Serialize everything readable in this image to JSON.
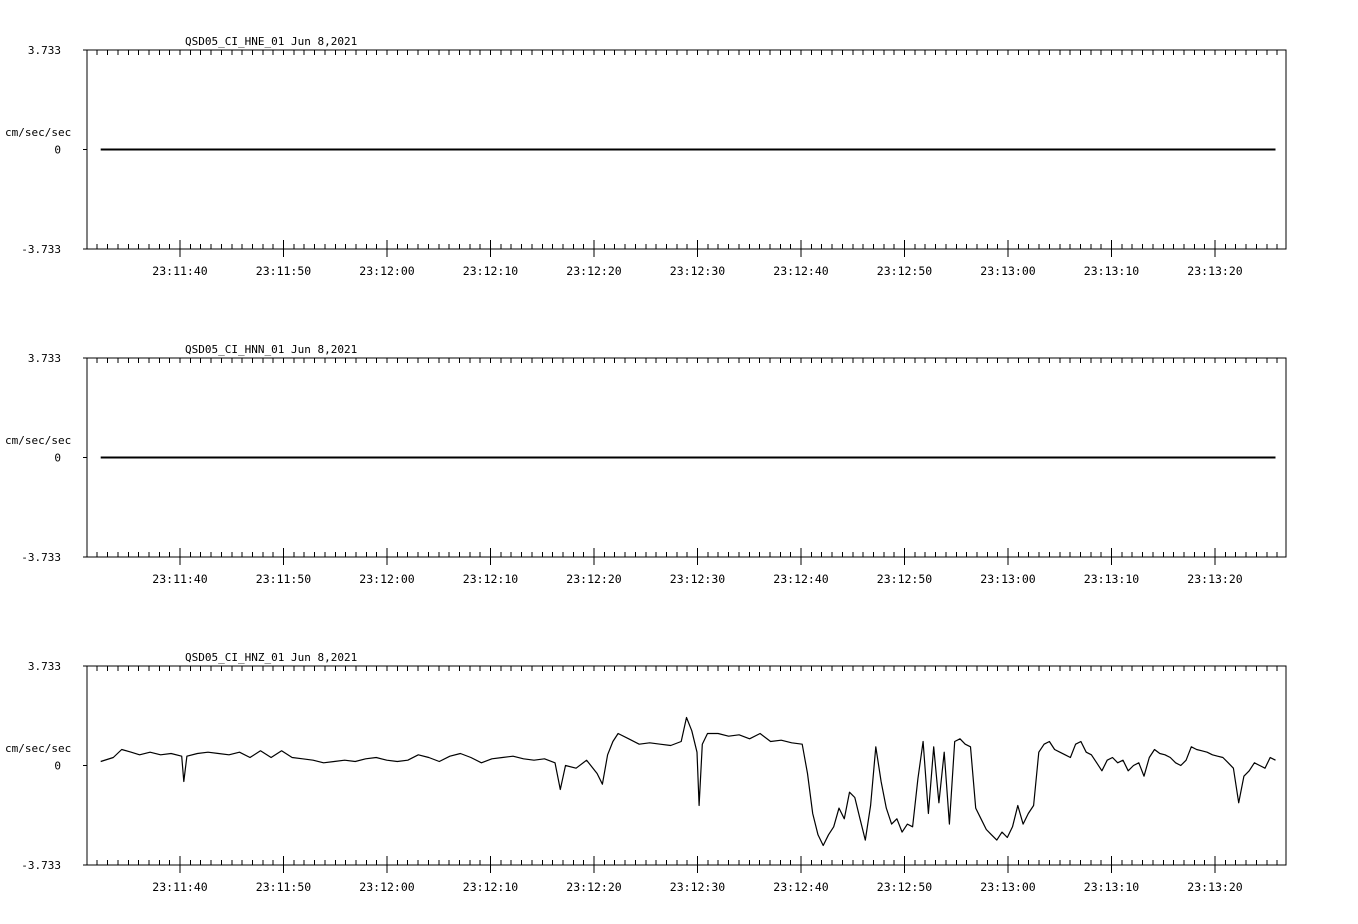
{
  "chart_data": [
    {
      "type": "line",
      "title": "QSD05_CI_HNE_01  Jun 8,2021",
      "ylabel": "cm/sec/sec",
      "ylim": [
        -3.733,
        3.733
      ],
      "y_tick_labels": [
        "3.733",
        "0",
        "-3.733"
      ],
      "x_tick_labels": [
        "23:11:40",
        "23:11:50",
        "23:12:00",
        "23:12:10",
        "23:12:20",
        "23:12:30",
        "23:12:40",
        "23:12:50",
        "23:13:00",
        "23:13:10",
        "23:13:20"
      ],
      "x_start_seconds_of_day": 83492,
      "x_end_seconds_of_day": 83606,
      "series": [
        {
          "values": [
            [
              83493.3,
              0
            ],
            [
              83605.0,
              0
            ]
          ]
        }
      ]
    },
    {
      "type": "line",
      "title": "QSD05_CI_HNN_01  Jun 8,2021",
      "ylabel": "cm/sec/sec",
      "ylim": [
        -3.733,
        3.733
      ],
      "y_tick_labels": [
        "3.733",
        "0",
        "-3.733"
      ],
      "x_tick_labels": [
        "23:11:40",
        "23:11:50",
        "23:12:00",
        "23:12:10",
        "23:12:20",
        "23:12:30",
        "23:12:40",
        "23:12:50",
        "23:13:00",
        "23:13:10",
        "23:13:20"
      ],
      "x_start_seconds_of_day": 83492,
      "x_end_seconds_of_day": 83606,
      "series": [
        {
          "values": [
            [
              83493.3,
              0
            ],
            [
              83605.0,
              0
            ]
          ]
        }
      ]
    },
    {
      "type": "line",
      "title": "QSD05_CI_HNZ_01  Jun 8,2021",
      "ylabel": "cm/sec/sec",
      "ylim": [
        -3.733,
        3.733
      ],
      "y_tick_labels": [
        "3.733",
        "0",
        "-3.733"
      ],
      "x_tick_labels": [
        "23:11:40",
        "23:11:50",
        "23:12:00",
        "23:12:10",
        "23:12:20",
        "23:12:30",
        "23:12:40",
        "23:12:50",
        "23:13:00",
        "23:13:10",
        "23:13:20"
      ],
      "x_start_seconds_of_day": 83492,
      "x_end_seconds_of_day": 83606,
      "series": [
        {
          "values": [
            [
              83493.3,
              0.15
            ],
            [
              83494.5,
              0.3
            ],
            [
              83495.3,
              0.6
            ],
            [
              83496.2,
              0.5
            ],
            [
              83497.0,
              0.4
            ],
            [
              83498.0,
              0.5
            ],
            [
              83499.0,
              0.4
            ],
            [
              83500.0,
              0.45
            ],
            [
              83501.0,
              0.35
            ],
            [
              83501.2,
              -0.6
            ],
            [
              83501.5,
              0.35
            ],
            [
              83502.5,
              0.45
            ],
            [
              83503.5,
              0.5
            ],
            [
              83504.5,
              0.45
            ],
            [
              83505.5,
              0.4
            ],
            [
              83506.5,
              0.5
            ],
            [
              83507.5,
              0.3
            ],
            [
              83508.5,
              0.55
            ],
            [
              83509.5,
              0.3
            ],
            [
              83510.5,
              0.55
            ],
            [
              83511.5,
              0.3
            ],
            [
              83512.5,
              0.25
            ],
            [
              83513.5,
              0.2
            ],
            [
              83514.5,
              0.1
            ],
            [
              83515.5,
              0.15
            ],
            [
              83516.5,
              0.2
            ],
            [
              83517.5,
              0.15
            ],
            [
              83518.5,
              0.25
            ],
            [
              83519.5,
              0.3
            ],
            [
              83520.5,
              0.2
            ],
            [
              83521.5,
              0.15
            ],
            [
              83522.5,
              0.2
            ],
            [
              83523.5,
              0.4
            ],
            [
              83524.5,
              0.3
            ],
            [
              83525.5,
              0.15
            ],
            [
              83526.5,
              0.35
            ],
            [
              83527.5,
              0.45
            ],
            [
              83528.5,
              0.3
            ],
            [
              83529.5,
              0.1
            ],
            [
              83530.5,
              0.25
            ],
            [
              83531.5,
              0.3
            ],
            [
              83532.5,
              0.35
            ],
            [
              83533.5,
              0.25
            ],
            [
              83534.5,
              0.2
            ],
            [
              83535.5,
              0.25
            ],
            [
              83536.5,
              0.1
            ],
            [
              83537.0,
              -0.9
            ],
            [
              83537.5,
              0.0
            ],
            [
              83538.5,
              -0.1
            ],
            [
              83539.5,
              0.2
            ],
            [
              83540.5,
              -0.3
            ],
            [
              83541.0,
              -0.7
            ],
            [
              83541.5,
              0.4
            ],
            [
              83542.0,
              0.9
            ],
            [
              83542.5,
              1.2
            ],
            [
              83543.5,
              1.0
            ],
            [
              83544.5,
              0.8
            ],
            [
              83545.5,
              0.85
            ],
            [
              83546.5,
              0.8
            ],
            [
              83547.5,
              0.75
            ],
            [
              83548.5,
              0.9
            ],
            [
              83549.0,
              1.8
            ],
            [
              83549.5,
              1.3
            ],
            [
              83550.0,
              0.5
            ],
            [
              83550.2,
              -1.5
            ],
            [
              83550.5,
              0.8
            ],
            [
              83551.0,
              1.2
            ],
            [
              83552.0,
              1.2
            ],
            [
              83553.0,
              1.1
            ],
            [
              83554.0,
              1.15
            ],
            [
              83555.0,
              1.0
            ],
            [
              83556.0,
              1.2
            ],
            [
              83557.0,
              0.9
            ],
            [
              83558.0,
              0.95
            ],
            [
              83559.0,
              0.85
            ],
            [
              83560.0,
              0.8
            ],
            [
              83560.5,
              -0.3
            ],
            [
              83561.0,
              -1.8
            ],
            [
              83561.5,
              -2.6
            ],
            [
              83562.0,
              -3.0
            ],
            [
              83562.5,
              -2.6
            ],
            [
              83563.0,
              -2.3
            ],
            [
              83563.5,
              -1.6
            ],
            [
              83564.0,
              -2.0
            ],
            [
              83564.5,
              -1.0
            ],
            [
              83565.0,
              -1.2
            ],
            [
              83565.5,
              -2.0
            ],
            [
              83566.0,
              -2.8
            ],
            [
              83566.5,
              -1.5
            ],
            [
              83567.0,
              0.7
            ],
            [
              83567.5,
              -0.6
            ],
            [
              83568.0,
              -1.6
            ],
            [
              83568.5,
              -2.2
            ],
            [
              83569.0,
              -2.0
            ],
            [
              83569.5,
              -2.5
            ],
            [
              83570.0,
              -2.2
            ],
            [
              83570.5,
              -2.3
            ],
            [
              83571.0,
              -0.5
            ],
            [
              83571.5,
              0.9
            ],
            [
              83572.0,
              -1.8
            ],
            [
              83572.5,
              0.7
            ],
            [
              83573.0,
              -1.4
            ],
            [
              83573.5,
              0.5
            ],
            [
              83574.0,
              -2.2
            ],
            [
              83574.5,
              0.9
            ],
            [
              83575.0,
              1.0
            ],
            [
              83575.5,
              0.8
            ],
            [
              83576.0,
              0.7
            ],
            [
              83576.5,
              -1.6
            ],
            [
              83577.0,
              -2.0
            ],
            [
              83577.5,
              -2.4
            ],
            [
              83578.0,
              -2.6
            ],
            [
              83578.5,
              -2.8
            ],
            [
              83579.0,
              -2.5
            ],
            [
              83579.5,
              -2.7
            ],
            [
              83580.0,
              -2.3
            ],
            [
              83580.5,
              -1.5
            ],
            [
              83581.0,
              -2.2
            ],
            [
              83581.5,
              -1.8
            ],
            [
              83582.0,
              -1.5
            ],
            [
              83582.5,
              0.5
            ],
            [
              83583.0,
              0.8
            ],
            [
              83583.5,
              0.9
            ],
            [
              83584.0,
              0.6
            ],
            [
              83584.5,
              0.5
            ],
            [
              83585.0,
              0.4
            ],
            [
              83585.5,
              0.3
            ],
            [
              83586.0,
              0.8
            ],
            [
              83586.5,
              0.9
            ],
            [
              83587.0,
              0.5
            ],
            [
              83587.5,
              0.4
            ],
            [
              83588.0,
              0.1
            ],
            [
              83588.5,
              -0.2
            ],
            [
              83589.0,
              0.2
            ],
            [
              83589.5,
              0.3
            ],
            [
              83590.0,
              0.1
            ],
            [
              83590.5,
              0.2
            ],
            [
              83591.0,
              -0.2
            ],
            [
              83591.5,
              0.0
            ],
            [
              83592.0,
              0.1
            ],
            [
              83592.5,
              -0.4
            ],
            [
              83593.0,
              0.3
            ],
            [
              83593.5,
              0.6
            ],
            [
              83594.0,
              0.45
            ],
            [
              83594.5,
              0.4
            ],
            [
              83595.0,
              0.3
            ],
            [
              83595.5,
              0.1
            ],
            [
              83596.0,
              0.0
            ],
            [
              83596.5,
              0.2
            ],
            [
              83597.0,
              0.7
            ],
            [
              83597.5,
              0.6
            ],
            [
              83598.0,
              0.55
            ],
            [
              83598.5,
              0.5
            ],
            [
              83599.0,
              0.4
            ],
            [
              83599.5,
              0.35
            ],
            [
              83600.0,
              0.3
            ],
            [
              83600.5,
              0.1
            ],
            [
              83601.0,
              -0.1
            ],
            [
              83601.5,
              -1.4
            ],
            [
              83602.0,
              -0.4
            ],
            [
              83602.5,
              -0.2
            ],
            [
              83603.0,
              0.1
            ],
            [
              83603.5,
              0.0
            ],
            [
              83604.0,
              -0.1
            ],
            [
              83604.5,
              0.3
            ],
            [
              83605.0,
              0.2
            ]
          ]
        }
      ]
    }
  ]
}
